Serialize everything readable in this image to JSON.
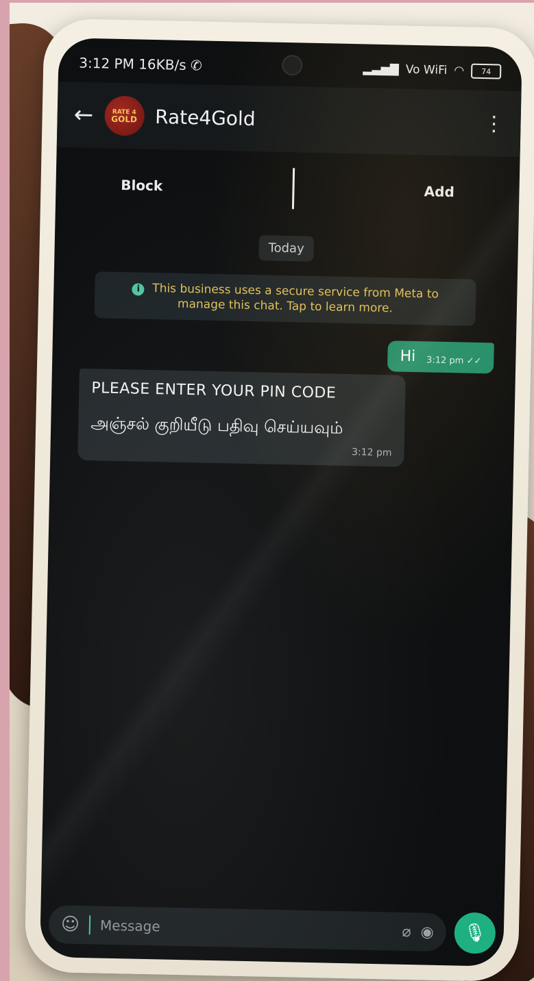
{
  "status_bar": {
    "time": "3:12 PM",
    "data_speed": "16KB/s",
    "vowifi": "Vo WiFi",
    "battery": "74"
  },
  "header": {
    "back_icon": "back-arrow-icon",
    "avatar_top": "RATE 4",
    "avatar_bottom": "GOLD",
    "contact_name": "Rate4Gold",
    "menu_icon": "more-vert-icon"
  },
  "actions": {
    "block_label": "Block",
    "add_label": "Add"
  },
  "chat": {
    "date_label": "Today",
    "notice_text": "This business uses a secure service from Meta to manage this chat. Tap to learn more.",
    "messages": [
      {
        "direction": "out",
        "text": "Hi",
        "time": "3:12 pm"
      },
      {
        "direction": "in",
        "line1": "PLEASE ENTER YOUR PIN CODE",
        "line2": "அஞ்சல் குறியீடு பதிவு செய்யவும்",
        "time": "3:12 pm"
      }
    ]
  },
  "composer": {
    "placeholder": "Message",
    "emoji_icon": "emoji-icon",
    "attach_icon": "paperclip-icon",
    "camera_icon": "camera-icon",
    "mic_icon": "microphone-icon"
  },
  "colors": {
    "accent_green": "#1f8f6c",
    "notice_text": "#e0c15a",
    "chat_bg": "#0d0f10"
  }
}
